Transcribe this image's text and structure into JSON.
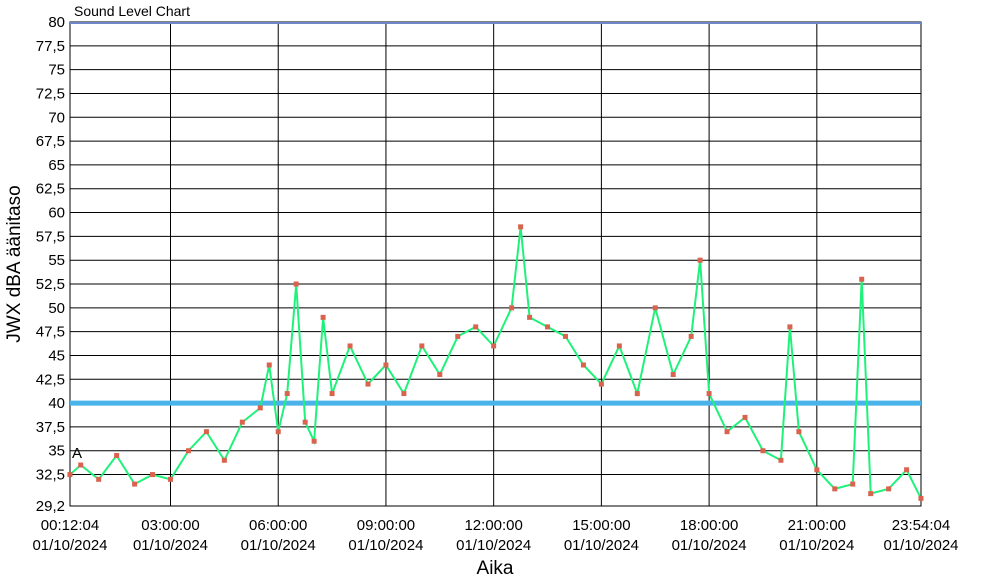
{
  "chart_data": {
    "type": "line",
    "title": "Sound Level Chart",
    "xlabel": "Aika",
    "ylabel": "JWX dBA äänitaso",
    "annotation": "A",
    "ylim": [
      29.2,
      80
    ],
    "xlim": [
      "00:12:04",
      "23:54:04"
    ],
    "y_ticks": [
      "29,2",
      "32,5",
      "35",
      "37,5",
      "40",
      "42,5",
      "45",
      "47,5",
      "50",
      "52,5",
      "55",
      "57,5",
      "60",
      "62,5",
      "65",
      "67,5",
      "70",
      "72,5",
      "75",
      "77,5",
      "80"
    ],
    "x_ticks": [
      {
        "time": "00:12:04",
        "date": "01/10/2024"
      },
      {
        "time": "03:00:00",
        "date": "01/10/2024"
      },
      {
        "time": "06:00:00",
        "date": "01/10/2024"
      },
      {
        "time": "09:00:00",
        "date": "01/10/2024"
      },
      {
        "time": "12:00:00",
        "date": "01/10/2024"
      },
      {
        "time": "15:00:00",
        "date": "01/10/2024"
      },
      {
        "time": "18:00:00",
        "date": "01/10/2024"
      },
      {
        "time": "21:00:00",
        "date": "01/10/2024"
      },
      {
        "time": "23:54:04",
        "date": "01/10/2024"
      }
    ],
    "reference_line": {
      "y": 40,
      "color": "#4ab4ea"
    },
    "top_line": {
      "y": 80,
      "color": "#6f86c8"
    },
    "grid": true,
    "series": [
      {
        "line_color": "#1ff27a",
        "marker_color": "#d9634e",
        "x": [
          "00:12",
          "00:30",
          "01:00",
          "01:30",
          "02:00",
          "02:30",
          "03:00",
          "03:30",
          "04:00",
          "04:30",
          "05:00",
          "05:30",
          "05:45",
          "06:00",
          "06:15",
          "06:30",
          "06:45",
          "07:00",
          "07:15",
          "07:30",
          "08:00",
          "08:30",
          "09:00",
          "09:30",
          "10:00",
          "10:30",
          "11:00",
          "11:30",
          "12:00",
          "12:30",
          "12:45",
          "13:00",
          "13:30",
          "14:00",
          "14:30",
          "15:00",
          "15:30",
          "16:00",
          "16:30",
          "17:00",
          "17:30",
          "17:45",
          "18:00",
          "18:30",
          "19:00",
          "19:30",
          "20:00",
          "20:15",
          "20:30",
          "21:00",
          "21:30",
          "22:00",
          "22:15",
          "22:30",
          "23:00",
          "23:30",
          "23:54"
        ],
        "y": [
          32.5,
          33.5,
          32.0,
          34.5,
          31.5,
          32.5,
          32.0,
          35.0,
          37.0,
          34.0,
          38.0,
          39.5,
          44.0,
          37.0,
          41.0,
          52.5,
          38.0,
          36.0,
          49.0,
          41.0,
          46.0,
          42.0,
          44.0,
          41.0,
          46.0,
          43.0,
          47.0,
          48.0,
          46.0,
          50.0,
          58.5,
          49.0,
          48.0,
          47.0,
          44.0,
          42.0,
          46.0,
          41.0,
          50.0,
          43.0,
          47.0,
          55.0,
          41.0,
          37.0,
          38.5,
          35.0,
          34.0,
          48.0,
          37.0,
          33.0,
          31.0,
          31.5,
          53.0,
          30.5,
          31.0,
          33.0,
          30.0
        ]
      }
    ]
  }
}
